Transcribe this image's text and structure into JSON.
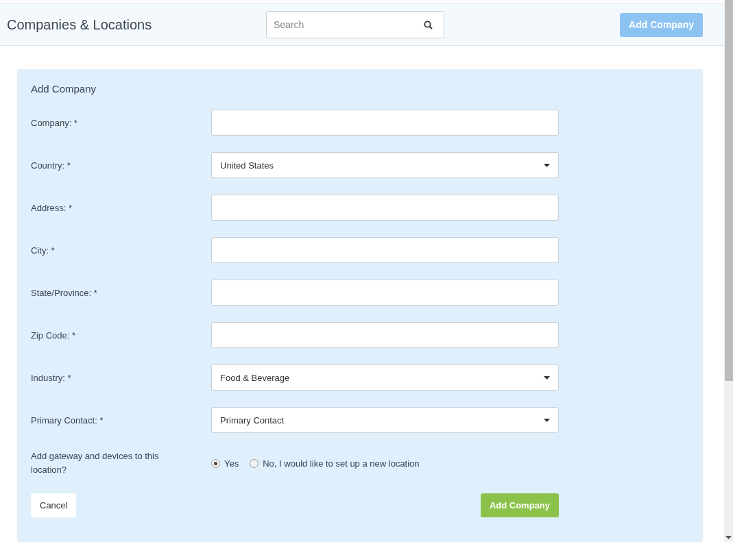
{
  "header": {
    "title": "Companies & Locations",
    "search": {
      "placeholder": "Search"
    },
    "add_button": "Add Company"
  },
  "form": {
    "title": "Add Company",
    "fields": [
      {
        "label": "Company: *",
        "kind": "text"
      },
      {
        "label": "Country: *",
        "kind": "select",
        "value": "United States"
      },
      {
        "label": "Address: *",
        "kind": "text"
      },
      {
        "label": "City: *",
        "kind": "text"
      },
      {
        "label": "State/Province: *",
        "kind": "text"
      },
      {
        "label": "Zip Code: *",
        "kind": "text"
      },
      {
        "label": "Industry: *",
        "kind": "select",
        "value": "Food & Beverage"
      },
      {
        "label": "Primary Contact: *",
        "kind": "select",
        "value": "Primary Contact"
      }
    ],
    "question": {
      "label": "Add gateway and devices to this location?",
      "options": [
        {
          "label": "Yes",
          "selected": true
        },
        {
          "label": "No, I would like to set up a new location",
          "selected": false
        }
      ]
    },
    "cancel_button": "Cancel",
    "submit_button": "Add Company"
  }
}
